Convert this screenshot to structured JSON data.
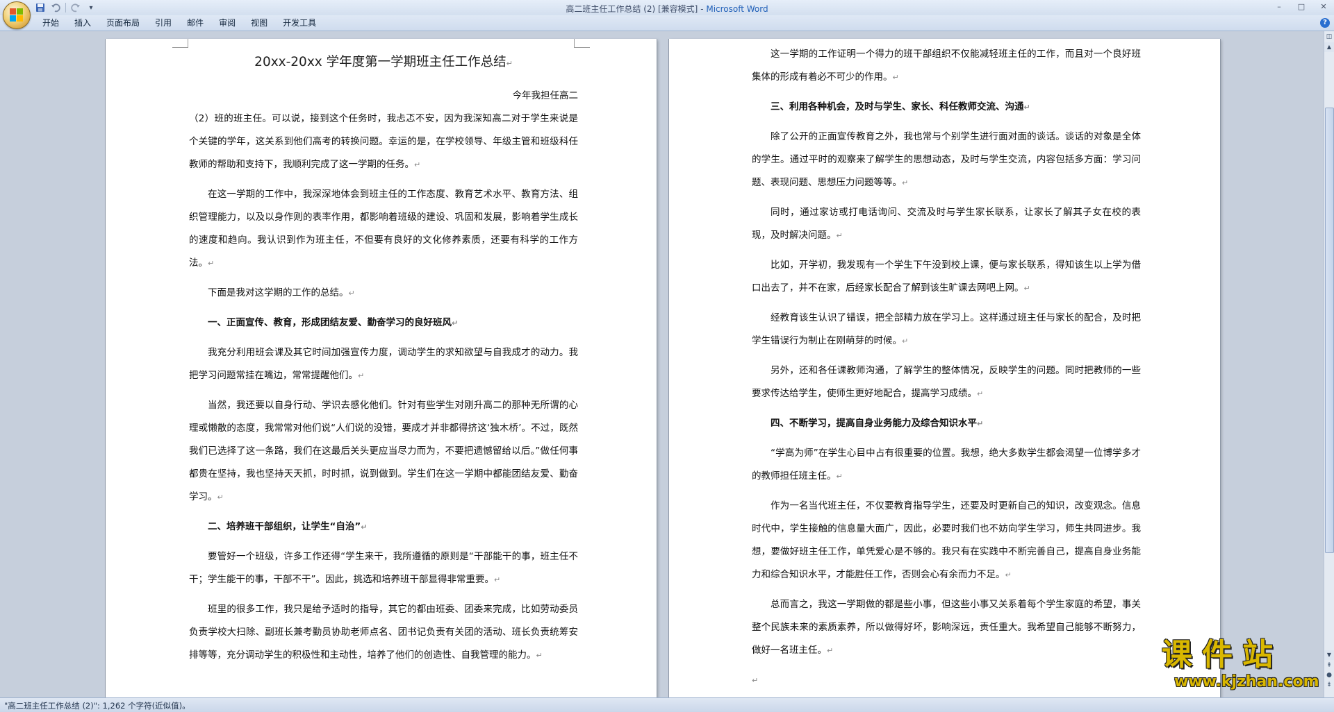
{
  "window": {
    "title": "高二班主任工作总结 (2) [兼容模式]",
    "title_sep": " - ",
    "app_name": "Microsoft Word",
    "controls": [
      "–",
      "□",
      "✕"
    ]
  },
  "quick_access": {
    "icons": [
      "save-icon",
      "undo-icon",
      "redo-icon",
      "customize-icon"
    ],
    "dropdown": "▾"
  },
  "ribbon": {
    "tabs": [
      "开始",
      "插入",
      "页面布局",
      "引用",
      "邮件",
      "审阅",
      "视图",
      "开发工具"
    ],
    "help": "?"
  },
  "document": {
    "left_page": {
      "title": "20xx-20xx 学年度第一学期班主任工作总结",
      "p1_right": "今年我担任高二",
      "p1": "（2）班的班主任。可以说，接到这个任务时，我忐忑不安，因为我深知高二对于学生来说是个关键的学年，这关系到他们高考的转换问题。幸运的是，在学校领导、年级主管和班级科任教师的帮助和支持下，我顺利完成了这一学期的任务。",
      "p2": "在这一学期的工作中，我深深地体会到班主任的工作态度、教育艺术水平、教育方法、组织管理能力，以及以身作则的表率作用，都影响着班级的建设、巩固和发展，影响着学生成长的速度和趋向。我认识到作为班主任，不但要有良好的文化修养素质，还要有科学的工作方法。",
      "p3": "下面是我对这学期的工作的总结。",
      "h1": "一、正面宣传、教育，形成团结友爱、勤奋学习的良好班风",
      "p4": "我充分利用班会课及其它时间加强宣传力度，调动学生的求知欲望与自我成才的动力。我把学习问题常挂在嘴边，常常提醒他们。",
      "p5": "当然，我还要以自身行动、学识去感化他们。针对有些学生对刚升高二的那种无所谓的心理或懒散的态度，我常常对他们说“人们说的没错，要成才并非都得挤这‘独木桥’。不过，既然我们已选择了这一条路，我们在这最后关头更应当尽力而为，不要把遗憾留给以后。”做任何事都贵在坚持，我也坚持天天抓，时时抓，说到做到。学生们在这一学期中都能团结友爱、勤奋学习。",
      "h2": "二、培养班干部组织，让学生“自治”",
      "p6": "要管好一个班级，许多工作还得“学生来干，我所遵循的原则是“干部能干的事，班主任不干；学生能干的事，干部不干”。因此，挑选和培养班干部显得非常重要。",
      "p7": "班里的很多工作，我只是给予适时的指导，其它的都由班委、团委来完成，比如劳动委员负责学校大扫除、副班长兼考勤员协助老师点名、团书记负责有关团的活动、班长负责统筹安排等等，充分调动学生的积极性和主动性，培养了他们的创造性、自我管理的能力。"
    },
    "right_page": {
      "p1": "这一学期的工作证明一个得力的班干部组织不仅能减轻班主任的工作，而且对一个良好班集体的形成有着必不可少的作用。",
      "h3": "三、利用各种机会，及时与学生、家长、科任教师交流、沟通",
      "p2": "除了公开的正面宣传教育之外，我也常与个别学生进行面对面的谈话。谈话的对象是全体的学生。通过平时的观察来了解学生的思想动态，及时与学生交流，内容包括多方面：学习问题、表现问题、思想压力问题等等。",
      "p3": "同时，通过家访或打电话询问、交流及时与学生家长联系，让家长了解其子女在校的表现，及时解决问题。",
      "p4": "比如，开学初，我发现有一个学生下午没到校上课，便与家长联系，得知该生以上学为借口出去了，并不在家，后经家长配合了解到该生旷课去网吧上网。",
      "p5": "经教育该生认识了错误，把全部精力放在学习上。这样通过班主任与家长的配合，及时把学生错误行为制止在刚萌芽的时候。",
      "p6": "另外，还和各任课教师沟通，了解学生的整体情况，反映学生的问题。同时把教师的一些要求传达给学生，使师生更好地配合，提高学习成绩。",
      "h4": "四、不断学习，提高自身业务能力及综合知识水平",
      "p7": "“学高为师”在学生心目中占有很重要的位置。我想，绝大多数学生都会渴望一位博学多才的教师担任班主任。",
      "p8": "作为一名当代班主任，不仅要教育指导学生，还要及时更新自己的知识，改变观念。信息时代中，学生接触的信息量大面广，因此，必要时我们也不妨向学生学习，师生共同进步。我想，要做好班主任工作，单凭爱心是不够的。我只有在实践中不断完善自己，提高自身业务能力和综合知识水平，才能胜任工作，否则会心有余而力不足。",
      "p9": "总而言之，我这一学期做的都是些小事，但这些小事又关系着每个学生家庭的希望，事关整个民族未来的素质素养，所以做得好坏，影响深远，责任重大。我希望自己能够不断努力，做好一名班主任。"
    },
    "para_mark": "↵"
  },
  "statusbar": {
    "text": "\"高二班主任工作总结 (2)\": 1,262 个字符(近似值)。"
  },
  "watermark": {
    "brand": "课件站",
    "url": "www.kjzhan.com"
  }
}
